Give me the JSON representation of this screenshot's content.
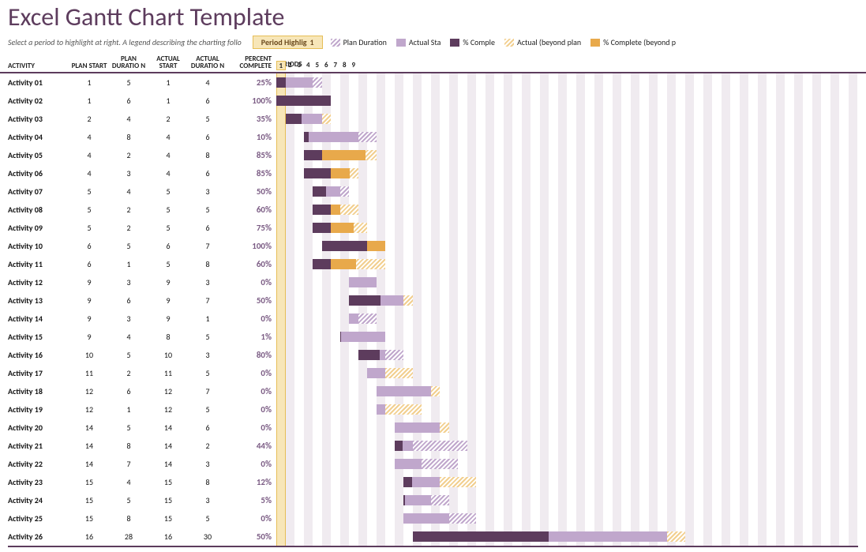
{
  "title": "Excel Gantt Chart Template",
  "legend_note": "Select a period to highlight at right.  A legend describing the charting follo",
  "period_highlight_label": "Period Highlig",
  "period_highlight_value": "1",
  "legend": {
    "plan": "Plan Duration",
    "actual_start": "Actual Sta",
    "percent_complete": "% Comple",
    "actual_beyond": "Actual (beyond plan",
    "complete_beyond": "% Complete (beyond p"
  },
  "columns": {
    "activity": "ACTIVITY",
    "plan_start": "PLAN START",
    "plan_duration": "PLAN DURATIO N",
    "actual_start": "ACTUAL START",
    "actual_duration": "ACTUAL DURATIO N",
    "percent_complete": "PERCENT COMPLETE",
    "periods": "PERIODS"
  },
  "period_ticks": [
    "1",
    "2",
    "3",
    "4",
    "5",
    "6",
    "7",
    "8",
    "9"
  ],
  "highlight_period": 1,
  "periods_total": 64,
  "chart_data": {
    "type": "bar",
    "title": "Excel Gantt Chart Template",
    "xlabel": "PERIODS",
    "ylabel": "ACTIVITY",
    "xlim": [
      1,
      64
    ],
    "legend": [
      "Plan Duration",
      "Actual Start",
      "% Complete",
      "Actual (beyond plan)",
      "% Complete (beyond plan)"
    ],
    "rows": [
      {
        "activity": "Activity 01",
        "plan_start": 1,
        "plan_duration": 5,
        "actual_start": 1,
        "actual_duration": 4,
        "percent_complete": 25
      },
      {
        "activity": "Activity 02",
        "plan_start": 1,
        "plan_duration": 6,
        "actual_start": 1,
        "actual_duration": 6,
        "percent_complete": 100
      },
      {
        "activity": "Activity 03",
        "plan_start": 2,
        "plan_duration": 4,
        "actual_start": 2,
        "actual_duration": 5,
        "percent_complete": 35
      },
      {
        "activity": "Activity 04",
        "plan_start": 4,
        "plan_duration": 8,
        "actual_start": 4,
        "actual_duration": 6,
        "percent_complete": 10
      },
      {
        "activity": "Activity 05",
        "plan_start": 4,
        "plan_duration": 2,
        "actual_start": 4,
        "actual_duration": 8,
        "percent_complete": 85
      },
      {
        "activity": "Activity 06",
        "plan_start": 4,
        "plan_duration": 3,
        "actual_start": 4,
        "actual_duration": 6,
        "percent_complete": 85
      },
      {
        "activity": "Activity 07",
        "plan_start": 5,
        "plan_duration": 4,
        "actual_start": 5,
        "actual_duration": 3,
        "percent_complete": 50
      },
      {
        "activity": "Activity 08",
        "plan_start": 5,
        "plan_duration": 2,
        "actual_start": 5,
        "actual_duration": 5,
        "percent_complete": 60
      },
      {
        "activity": "Activity 09",
        "plan_start": 5,
        "plan_duration": 2,
        "actual_start": 5,
        "actual_duration": 6,
        "percent_complete": 75
      },
      {
        "activity": "Activity 10",
        "plan_start": 6,
        "plan_duration": 5,
        "actual_start": 6,
        "actual_duration": 7,
        "percent_complete": 100
      },
      {
        "activity": "Activity 11",
        "plan_start": 6,
        "plan_duration": 1,
        "actual_start": 5,
        "actual_duration": 8,
        "percent_complete": 60
      },
      {
        "activity": "Activity 12",
        "plan_start": 9,
        "plan_duration": 3,
        "actual_start": 9,
        "actual_duration": 3,
        "percent_complete": 0
      },
      {
        "activity": "Activity 13",
        "plan_start": 9,
        "plan_duration": 6,
        "actual_start": 9,
        "actual_duration": 7,
        "percent_complete": 50
      },
      {
        "activity": "Activity 14",
        "plan_start": 9,
        "plan_duration": 3,
        "actual_start": 9,
        "actual_duration": 1,
        "percent_complete": 0
      },
      {
        "activity": "Activity 15",
        "plan_start": 9,
        "plan_duration": 4,
        "actual_start": 8,
        "actual_duration": 5,
        "percent_complete": 1
      },
      {
        "activity": "Activity 16",
        "plan_start": 10,
        "plan_duration": 5,
        "actual_start": 10,
        "actual_duration": 3,
        "percent_complete": 80
      },
      {
        "activity": "Activity 17",
        "plan_start": 11,
        "plan_duration": 2,
        "actual_start": 11,
        "actual_duration": 5,
        "percent_complete": 0
      },
      {
        "activity": "Activity 18",
        "plan_start": 12,
        "plan_duration": 6,
        "actual_start": 12,
        "actual_duration": 7,
        "percent_complete": 0
      },
      {
        "activity": "Activity 19",
        "plan_start": 12,
        "plan_duration": 1,
        "actual_start": 12,
        "actual_duration": 5,
        "percent_complete": 0
      },
      {
        "activity": "Activity 20",
        "plan_start": 14,
        "plan_duration": 5,
        "actual_start": 14,
        "actual_duration": 6,
        "percent_complete": 0
      },
      {
        "activity": "Activity 21",
        "plan_start": 14,
        "plan_duration": 8,
        "actual_start": 14,
        "actual_duration": 2,
        "percent_complete": 44
      },
      {
        "activity": "Activity 22",
        "plan_start": 14,
        "plan_duration": 7,
        "actual_start": 14,
        "actual_duration": 3,
        "percent_complete": 0
      },
      {
        "activity": "Activity 23",
        "plan_start": 15,
        "plan_duration": 4,
        "actual_start": 15,
        "actual_duration": 8,
        "percent_complete": 12
      },
      {
        "activity": "Activity 24",
        "plan_start": 15,
        "plan_duration": 5,
        "actual_start": 15,
        "actual_duration": 3,
        "percent_complete": 5
      },
      {
        "activity": "Activity 25",
        "plan_start": 15,
        "plan_duration": 8,
        "actual_start": 15,
        "actual_duration": 5,
        "percent_complete": 0
      },
      {
        "activity": "Activity 26",
        "plan_start": 16,
        "plan_duration": 28,
        "actual_start": 16,
        "actual_duration": 30,
        "percent_complete": 50
      }
    ]
  }
}
